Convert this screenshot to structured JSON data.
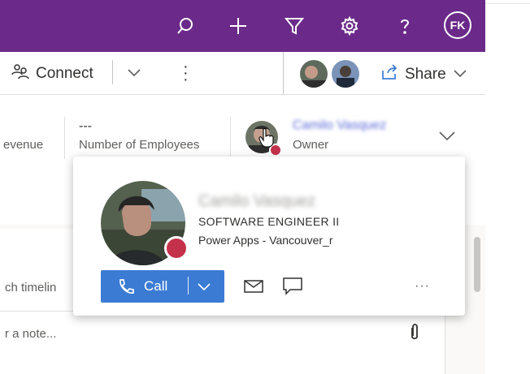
{
  "topbar": {
    "user_initials": "FK",
    "icons": [
      "search-icon",
      "plus-icon",
      "filter-icon",
      "gear-icon",
      "help-icon"
    ]
  },
  "commandbar": {
    "connect_label": "Connect",
    "share_label": "Share"
  },
  "header_fields": {
    "revenue_label": "evenue",
    "employees_value": "---",
    "employees_label": "Number of Employees",
    "owner_name": "Camilo Vasquez",
    "owner_label": "Owner"
  },
  "contact_card": {
    "name": "Camilo Vasquez",
    "title": "SOFTWARE ENGINEER II",
    "org": "Power Apps - Vancouver_r",
    "call_label": "Call",
    "presence_color": "#c4314b"
  },
  "timeline": {
    "search_placeholder": "ch timelin",
    "note_placeholder": "r a note..."
  },
  "colors": {
    "topbar": "#6b2a8a",
    "accent": "#3b7bd4"
  }
}
